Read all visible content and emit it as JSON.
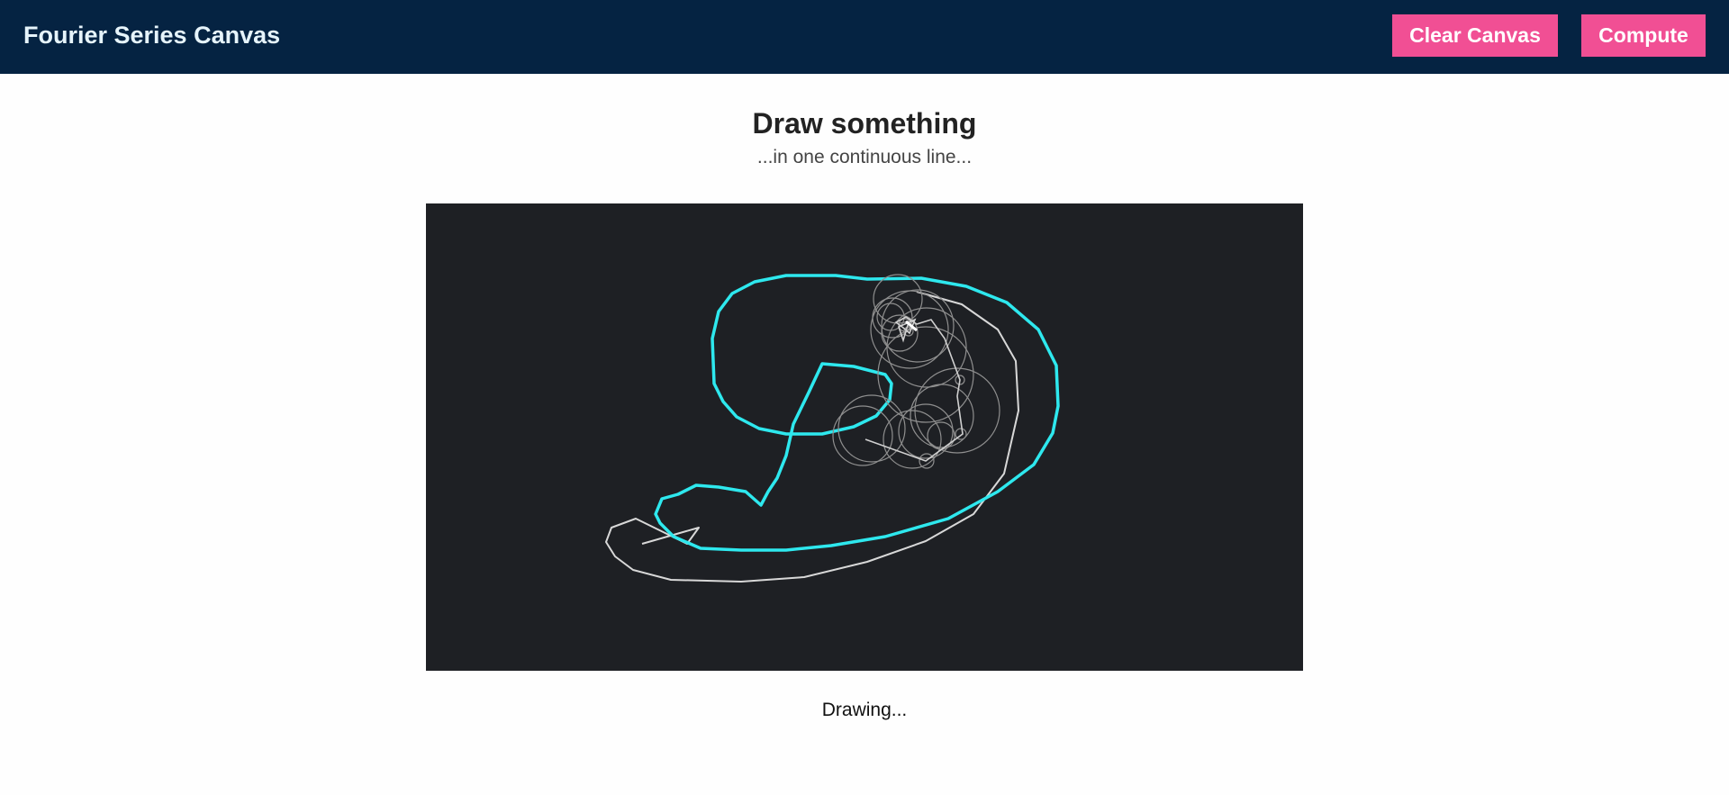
{
  "header": {
    "title": "Fourier Series Canvas",
    "clear_label": "Clear Canvas",
    "compute_label": "Compute"
  },
  "main": {
    "heading": "Draw something",
    "subheading": "...in one continuous line...",
    "status": "Drawing..."
  },
  "colors": {
    "header_bg": "#052342",
    "accent": "#f14f94",
    "canvas_bg": "#1e2024",
    "stroke": "#2ee8ee",
    "epicycle": "#9a9a9a"
  }
}
